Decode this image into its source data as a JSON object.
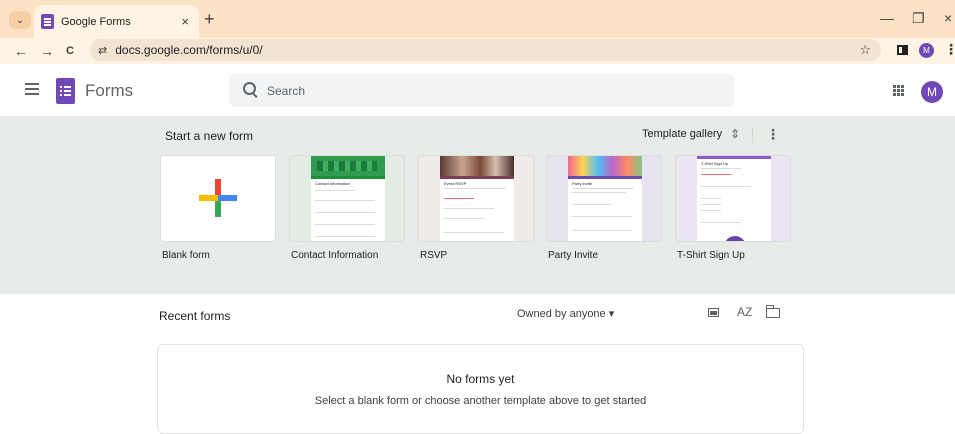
{
  "browser": {
    "tab_title": "Google Forms",
    "tab_close": "×",
    "new_tab": "+",
    "tab_list": "⌄",
    "url": "docs.google.com/forms/u/0/",
    "site_info": "⇄",
    "back": "←",
    "forward": "→",
    "reload": "C",
    "bookmark": "☆",
    "profile_initial": "M",
    "menu": "⋮",
    "minimize": "—",
    "restore": "❐",
    "close": "×"
  },
  "app": {
    "title": "Forms",
    "search_placeholder": "Search",
    "avatar_initial": "M"
  },
  "templates": {
    "heading": "Start a new form",
    "gallery_label": "Template gallery",
    "gallery_icon": "⇕",
    "more": "⋮",
    "items": [
      {
        "label": "Blank form"
      },
      {
        "label": "Contact Information",
        "doc_title": "Contact Information",
        "accent": "#1e8e3e"
      },
      {
        "label": "RSVP",
        "doc_title": "Event RSVP",
        "accent": "#7b3f4f"
      },
      {
        "label": "Party Invite",
        "doc_title": "Party Invite",
        "accent": "#6a4cae"
      },
      {
        "label": "T-Shirt Sign Up",
        "doc_title": "T-Shirt Sign Up",
        "accent": "#8e5ac7"
      }
    ]
  },
  "recent": {
    "heading": "Recent forms",
    "owner_filter": "Owned by anyone ▾",
    "sort_icon": "AZ",
    "empty_title": "No forms yet",
    "empty_subtitle": "Select a blank form or choose another template above to get started"
  },
  "colors": {
    "brand": "#7248b9",
    "chrome": "#fde3c5",
    "section_bg": "#e8ece8"
  }
}
